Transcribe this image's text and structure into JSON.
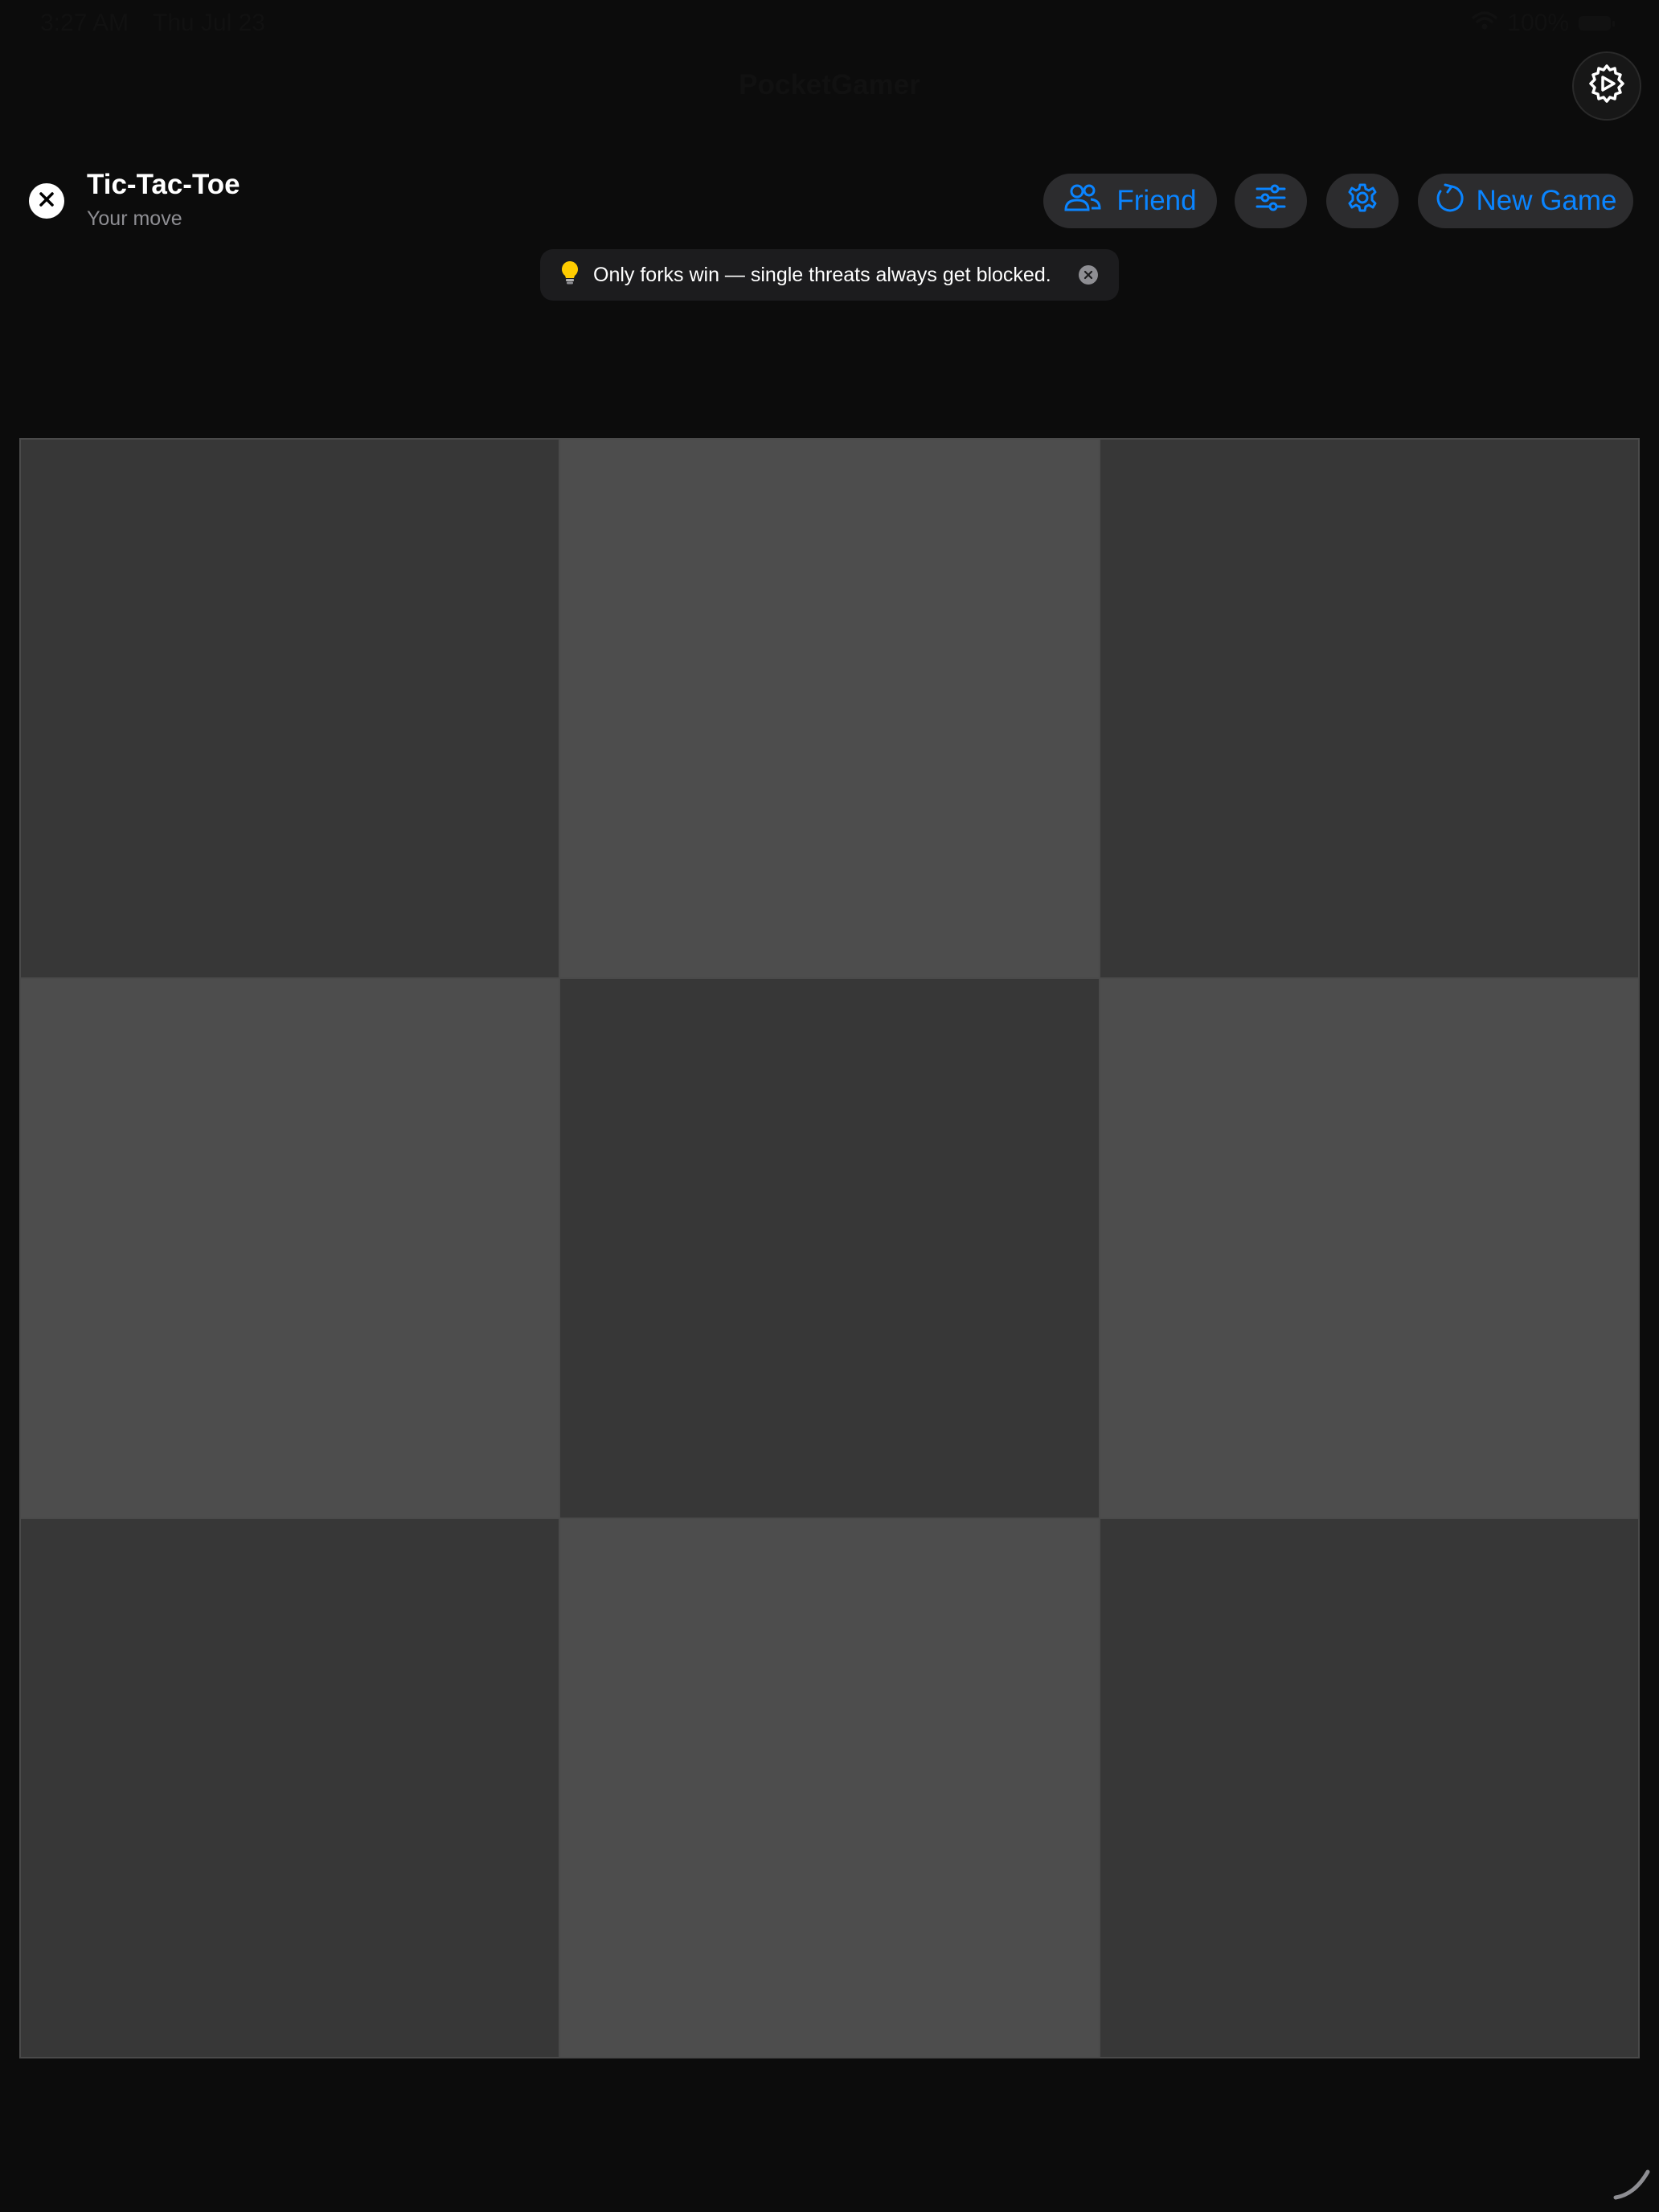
{
  "status_bar": {
    "time": "3:27 AM",
    "date": "Thu Jul 23",
    "battery": "100%",
    "icons": [
      "wifi-icon",
      "battery-icon"
    ]
  },
  "app": {
    "title": "PocketGamer"
  },
  "game": {
    "title": "Tic-Tac-Toe",
    "subtitle": "Your move"
  },
  "toolbar": {
    "friend_label": "Friend",
    "new_game_label": "New Game",
    "icons": [
      "person-2-icon",
      "sliders-icon",
      "gear-icon",
      "refresh-icon"
    ]
  },
  "hint": {
    "icon": "lightbulb-icon",
    "text": "Only forks win — single threats always get blocked."
  },
  "board": {
    "rows": 3,
    "cols": 3,
    "cells": [
      "",
      "",
      "",
      "",
      "",
      "",
      "",
      "",
      ""
    ]
  },
  "colors": {
    "background": "#0c0c0c",
    "accent": "#0a84ff",
    "pill": "#2c2c2e",
    "cell_dark": "#373737",
    "cell_light": "#4d4d4d"
  }
}
